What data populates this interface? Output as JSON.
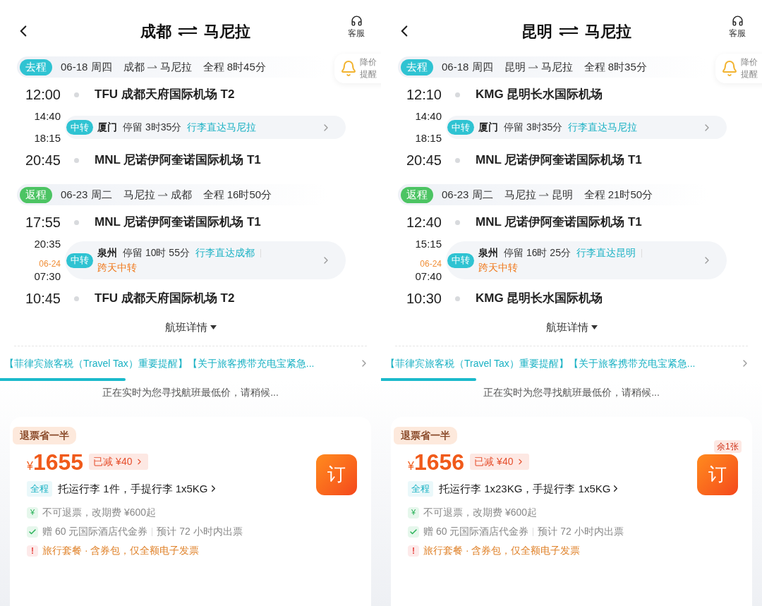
{
  "panels": [
    {
      "header": {
        "from": "成都",
        "to": "马尼拉",
        "service": "客服"
      },
      "price_alert": {
        "lines": [
          "降价",
          "提醒"
        ]
      },
      "legs": [
        {
          "kind": "outbound",
          "tag": "去程",
          "date": "06-18 周四",
          "route_from": "成都",
          "route_to": "马尼拉",
          "duration": "全程 8时45分",
          "departure": {
            "time": "12:00",
            "airport": "TFU 成都天府国际机场 T2"
          },
          "transfer": {
            "arrive_time": "14:40",
            "depart_time": "18:15",
            "tag": "中转",
            "city": "厦门",
            "stay": "停留 3时35分",
            "baggage": "行李直达马尼拉"
          },
          "arrival": {
            "time": "20:45",
            "airport": "MNL 尼诺伊阿奎诺国际机场 T1"
          }
        },
        {
          "kind": "return",
          "tag": "返程",
          "date": "06-23 周二",
          "route_from": "马尼拉",
          "route_to": "成都",
          "duration": "全程 16时50分",
          "departure": {
            "time": "17:55",
            "airport": "MNL 尼诺伊阿奎诺国际机场 T1"
          },
          "transfer": {
            "arrive_time": "20:35",
            "depart_date": "06-24",
            "depart_time": "07:30",
            "tag": "中转",
            "city": "泉州",
            "stay": "停留 10时 55分",
            "baggage": "行李直达成都",
            "note": "跨天中转"
          },
          "arrival": {
            "time": "10:45",
            "airport": "TFU 成都天府国际机场 T2"
          }
        }
      ],
      "details_link": "航班详情",
      "notice": "【菲律宾旅客税（Travel Tax）重要提醒】【关于旅客携带充电宝紧急...",
      "progress": {
        "level": 0.33
      },
      "loading": "正在实时为您寻找航班最低价，请稍候...",
      "offer": {
        "badge": "退票省一半",
        "currency": "¥",
        "price": "1655",
        "discount_label": "已减",
        "discount": "¥40",
        "scope": "全程",
        "baggage": "托运行李 1件，手提行李 1x5KG",
        "book": "订",
        "features": [
          {
            "kind": "refund",
            "mark": "¥",
            "text": "不可退票，改期费 ¥600起"
          },
          {
            "kind": "gift",
            "text": "赠 60 元国际酒店代金券",
            "extra": "预计 72 小时内出票"
          },
          {
            "kind": "warning",
            "mark": "!",
            "text": "旅行套餐 · 含券包，仅全额电子发票"
          }
        ]
      }
    },
    {
      "header": {
        "from": "昆明",
        "to": "马尼拉",
        "service": "客服"
      },
      "price_alert": {
        "lines": [
          "降价",
          "提醒"
        ]
      },
      "legs": [
        {
          "kind": "outbound",
          "tag": "去程",
          "date": "06-18 周四",
          "route_from": "昆明",
          "route_to": "马尼拉",
          "duration": "全程 8时35分",
          "departure": {
            "time": "12:10",
            "airport": "KMG 昆明长水国际机场"
          },
          "transfer": {
            "arrive_time": "14:40",
            "depart_time": "18:15",
            "tag": "中转",
            "city": "厦门",
            "stay": "停留 3时35分",
            "baggage": "行李直达马尼拉"
          },
          "arrival": {
            "time": "20:45",
            "airport": "MNL 尼诺伊阿奎诺国际机场 T1"
          }
        },
        {
          "kind": "return",
          "tag": "返程",
          "date": "06-23 周二",
          "route_from": "马尼拉",
          "route_to": "昆明",
          "duration": "全程 21时50分",
          "departure": {
            "time": "12:40",
            "airport": "MNL 尼诺伊阿奎诺国际机场 T1"
          },
          "transfer": {
            "arrive_time": "15:15",
            "depart_date": "06-24",
            "depart_time": "07:40",
            "tag": "中转",
            "city": "泉州",
            "stay": "停留 16时 25分",
            "baggage": "行李直达昆明",
            "note": "跨天中转"
          },
          "arrival": {
            "time": "10:30",
            "airport": "KMG 昆明长水国际机场"
          }
        }
      ],
      "details_link": "航班详情",
      "notice": "【菲律宾旅客税（Travel Tax）重要提醒】【关于旅客携带充电宝紧急...",
      "progress": {
        "level": 0.25
      },
      "loading": "正在实时为您寻找航班最低价，请稍候...",
      "offer": {
        "badge": "退票省一半",
        "currency": "¥",
        "price": "1656",
        "discount_label": "已减",
        "discount": "¥40",
        "scope": "全程",
        "baggage": "托运行李 1x23KG，手提行李 1x5KG",
        "book": "订",
        "remaining": "余1张",
        "features": [
          {
            "kind": "refund",
            "mark": "¥",
            "text": "不可退票，改期费 ¥600起"
          },
          {
            "kind": "gift",
            "text": "赠 60 元国际酒店代金券",
            "extra": "预计 72 小时内出票"
          },
          {
            "kind": "warning",
            "mark": "!",
            "text": "旅行套餐 · 含券包，仅全额电子发票"
          }
        ]
      }
    }
  ]
}
